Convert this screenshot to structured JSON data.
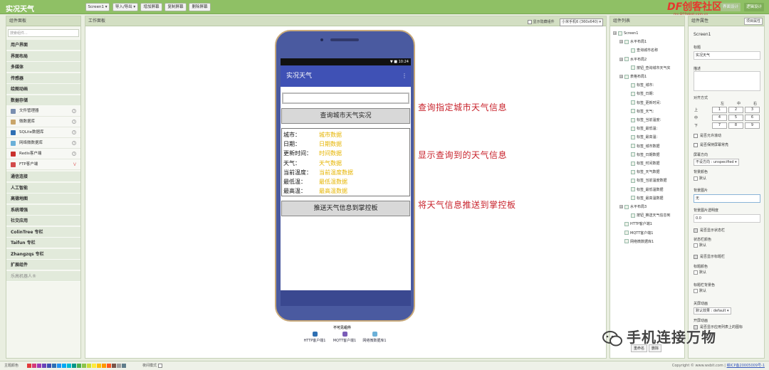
{
  "app": {
    "title": "实况天气"
  },
  "toolbar": {
    "screen_select": "Screen1 ▾",
    "import_export": "导入/导出 ▾",
    "add_screen": "增加屏幕",
    "copy_screen": "复制屏幕",
    "delete_screen": "删除屏幕",
    "right1": "界面设计",
    "right2": "逻辑设计"
  },
  "logo": {
    "main_df": "DF",
    "main_cn": "创客社区",
    "sub": "mc.DFRobot.com.cn"
  },
  "palette": {
    "header": "组件面板",
    "search_placeholder": "搜索组件...",
    "categories_top": [
      "用户界面",
      "界面布局",
      "多媒体",
      "传感器",
      "绘图动画",
      "数据存储"
    ],
    "storage_items": [
      {
        "label": "文件管理器",
        "mark": "?",
        "color": "#7a8fb0"
      },
      {
        "label": "微数据库",
        "mark": "?",
        "color": "#c9a56a"
      },
      {
        "label": "SQLite数据库",
        "mark": "?",
        "color": "#2f6fb3"
      },
      {
        "label": "网络微数据库",
        "mark": "?",
        "color": "#6bb0d8"
      },
      {
        "label": "Redis客户端",
        "mark": "?",
        "color": "#c9302c"
      },
      {
        "label": "FTP客户端",
        "mark": "V",
        "color": "#d24b4b"
      }
    ],
    "categories_bottom": [
      "通信连接",
      "人工智能",
      "高德地图",
      "系统增强",
      "社交应用",
      "ColinTree 专栏",
      "Taifun 专栏",
      "Zhangzqs 专栏",
      "扩展组件",
      "乐高机器人®"
    ]
  },
  "workspace": {
    "header": "工作面板",
    "show_hidden_label": "显示隐藏组件",
    "device_select": "小米手机6 (360x640) ▾"
  },
  "phone": {
    "time": "▼ ■ 10:24",
    "title": "实况天气",
    "menu": "⋮",
    "query_button": "查询城市天气实况",
    "push_button": "推送天气信息到掌控板",
    "rows": [
      {
        "label": "城市：",
        "value": "城市数据"
      },
      {
        "label": "日期：",
        "value": "日期数据"
      },
      {
        "label": "更新时间：",
        "value": "时间数据"
      },
      {
        "label": "天气：",
        "value": "天气数据"
      },
      {
        "label": "当前温度：",
        "value": "当前温度数据"
      },
      {
        "label": "最低温：",
        "value": "最低温数据"
      },
      {
        "label": "最高温：",
        "value": "最高温数据"
      }
    ]
  },
  "annotations": [
    "查询指定城市天气信息",
    "显示查询到的天气信息",
    "将天气信息推送到掌控板"
  ],
  "nonvisible": {
    "title": "不可见组件",
    "items": [
      {
        "label": "HTTP客户端1",
        "color": "#2f6fb3"
      },
      {
        "label": "MQTT客户端1",
        "color": "#7a5cb8"
      },
      {
        "label": "网络微数据库1",
        "color": "#6bb0d8"
      }
    ]
  },
  "components": {
    "header": "组件列表",
    "tree": [
      {
        "label": "Screen1",
        "depth": 0,
        "toggle": "⊟"
      },
      {
        "label": "水平布局1",
        "depth": 1,
        "toggle": "⊟"
      },
      {
        "label": "查询城市名称",
        "depth": 2,
        "toggle": ""
      },
      {
        "label": "水平布局2",
        "depth": 1,
        "toggle": "⊟"
      },
      {
        "label": "按钮_查询城市天气实",
        "depth": 2,
        "toggle": ""
      },
      {
        "label": "表格布局1",
        "depth": 1,
        "toggle": "⊟"
      },
      {
        "label": "标签_城市：",
        "depth": 2,
        "toggle": ""
      },
      {
        "label": "标签_日期：",
        "depth": 2,
        "toggle": ""
      },
      {
        "label": "标签_更新时间：",
        "depth": 2,
        "toggle": ""
      },
      {
        "label": "标签_天气：",
        "depth": 2,
        "toggle": ""
      },
      {
        "label": "标签_当前温度：",
        "depth": 2,
        "toggle": ""
      },
      {
        "label": "标签_最低温：",
        "depth": 2,
        "toggle": ""
      },
      {
        "label": "标签_最高温：",
        "depth": 2,
        "toggle": ""
      },
      {
        "label": "标签_城市数据",
        "depth": 2,
        "toggle": ""
      },
      {
        "label": "标签_日期数据",
        "depth": 2,
        "toggle": ""
      },
      {
        "label": "标签_时间数据",
        "depth": 2,
        "toggle": ""
      },
      {
        "label": "标签_天气数据",
        "depth": 2,
        "toggle": ""
      },
      {
        "label": "标签_当前温度数据",
        "depth": 2,
        "toggle": ""
      },
      {
        "label": "标签_最低温数据",
        "depth": 2,
        "toggle": ""
      },
      {
        "label": "标签_最高温数据",
        "depth": 2,
        "toggle": ""
      },
      {
        "label": "水平布局3",
        "depth": 1,
        "toggle": "⊟"
      },
      {
        "label": "按钮_推送天气信息到",
        "depth": 2,
        "toggle": ""
      },
      {
        "label": "HTTP客户端1",
        "depth": 1,
        "toggle": ""
      },
      {
        "label": "MQTT客户端1",
        "depth": 1,
        "toggle": ""
      },
      {
        "label": "网络微数据库1",
        "depth": 1,
        "toggle": ""
      }
    ],
    "rename_button": "重命名",
    "delete_button": "删除"
  },
  "properties": {
    "header": "组件属性",
    "tab": "项目属性",
    "component": "Screen1",
    "title_label": "标题",
    "title_value": "实况天气",
    "desc_label": "描述",
    "align_label": "对齐方式",
    "align_cols": [
      "左",
      "中",
      "右"
    ],
    "align_rows": [
      "上",
      "中",
      "下"
    ],
    "align_cells": [
      "1",
      "2",
      "3",
      "4",
      "5",
      "6",
      "7",
      "8",
      "9"
    ],
    "allow_scroll": "是否允许滚动",
    "keep_on": "是否保持屏幕常亮",
    "orientation_label": "屏幕方向",
    "orientation_value": "不设方向 : unspecified ▾",
    "bg_label": "背景颜色",
    "bg_value": "默认",
    "bgimg_label": "背景图片",
    "bgimg_value": "无",
    "bgimg_alpha_label": "背景图片透明度",
    "bgimg_alpha_value": "0.0",
    "show_status": "是否显示状态栏",
    "status_color_label": "状态栏颜色",
    "status_color_value": "默认",
    "show_title": "是否显示标题栏",
    "title_color_label": "标题颜色",
    "title_color_value": "默认",
    "titlebar_bg_label": "标题栏背景色",
    "titlebar_bg_value": "默认",
    "anim_label": "关屏动画",
    "anim_value": "默认效果 : default ▾",
    "open_anim_label": "开屏动画",
    "last_cb": "是否显示应用列表上的图标"
  },
  "bottom": {
    "theme_label": "主题颜色",
    "swatches": [
      "#e23b3b",
      "#d43b7a",
      "#9c3bb8",
      "#6a45b8",
      "#3f51b5",
      "#2f6fb3",
      "#2196f3",
      "#03a9f4",
      "#00bcd4",
      "#009688",
      "#4caf50",
      "#8bc34a",
      "#cddc39",
      "#ffeb3b",
      "#ffc107",
      "#ff9800",
      "#ff5722",
      "#795548",
      "#9e9e9e",
      "#607d8b"
    ],
    "mode_label": "夜间模式",
    "copyright": "Copyright © www.wxbit.com | ",
    "link": "赣ICP备20005009号-1"
  },
  "watermark": {
    "text": "手机连接万物"
  }
}
